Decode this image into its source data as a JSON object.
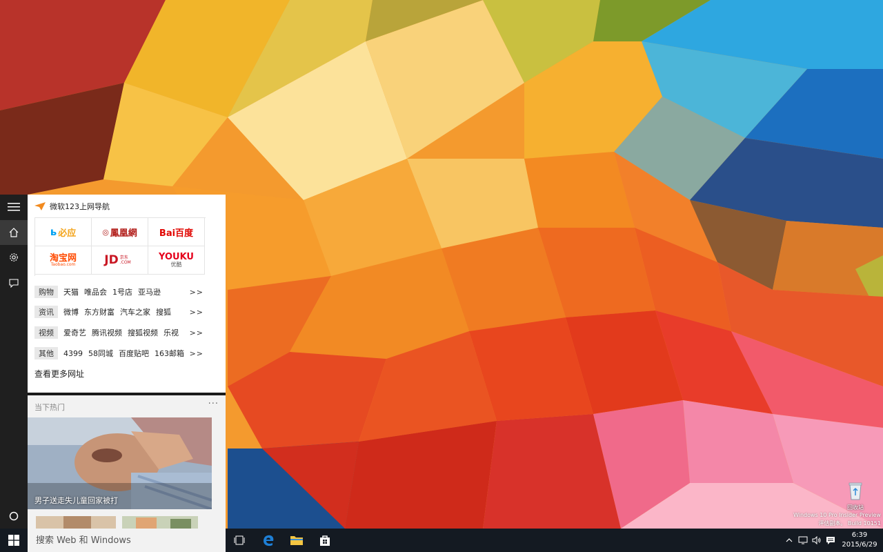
{
  "cortana": {
    "nav_title": "微软123上网导航",
    "logos": [
      {
        "name": "bing",
        "label": "必应"
      },
      {
        "name": "ifeng",
        "label": "鳳凰網"
      },
      {
        "name": "baidu",
        "label": "Bai百度"
      },
      {
        "name": "taobao",
        "label": "淘宝网",
        "sub": "Taobao.com"
      },
      {
        "name": "jd",
        "label": "JD",
        "sub": "京东 .COM"
      },
      {
        "name": "youku",
        "label": "YOUKU",
        "sub": "优酷"
      }
    ],
    "categories": [
      {
        "tag": "购物",
        "links": [
          "天猫",
          "唯品会",
          "1号店",
          "亚马逊"
        ],
        "more": ">>"
      },
      {
        "tag": "资讯",
        "links": [
          "微博",
          "东方财富",
          "汽车之家",
          "搜狐"
        ],
        "more": ">>"
      },
      {
        "tag": "视频",
        "links": [
          "爱奇艺",
          "腾讯视频",
          "搜狐视频",
          "乐视"
        ],
        "more": ">>"
      },
      {
        "tag": "其他",
        "links": [
          "4399",
          "58同城",
          "百度贴吧",
          "163邮箱"
        ],
        "more": ">>"
      }
    ],
    "more_sites": "查看更多网址",
    "hot_title": "当下热门",
    "hot_more": "···",
    "hot_caption": "男子送走失儿童回家被打"
  },
  "taskbar": {
    "search_placeholder": "搜索 Web 和 Windows",
    "time": "6:39",
    "date": "2015/6/29"
  },
  "desktop": {
    "recycle_bin_label": "回收站",
    "watermark_line1": "Windows 10 Pro Insider Preview",
    "watermark_line2": "评估副本。 Build 10151"
  },
  "colors": {
    "taskbar": "#141a22",
    "rail": "#1f1f1f",
    "edge_blue": "#1e7fd6",
    "explorer_yellow": "#f4c542"
  }
}
